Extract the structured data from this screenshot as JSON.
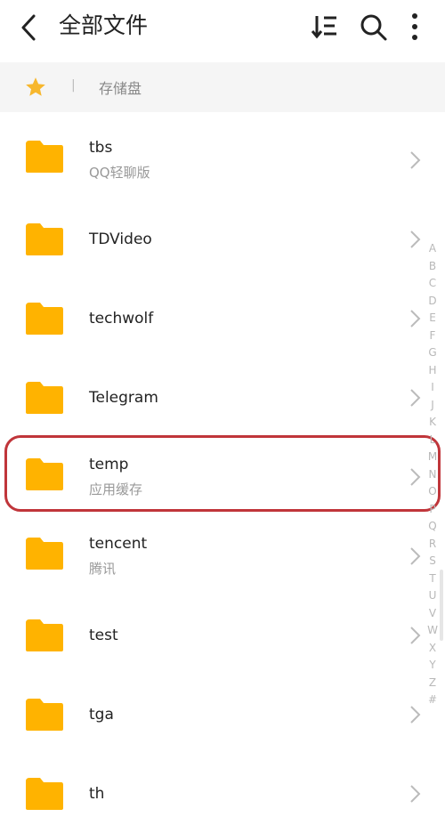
{
  "header": {
    "title": "全部文件"
  },
  "breadcrumb": {
    "separator": "|",
    "current": "存储盘"
  },
  "colors": {
    "folder": "#FFB300",
    "accent_star": "#F7B72D",
    "highlight": "#C0353A"
  },
  "icons": [
    "back-arrow-icon",
    "sort-icon",
    "search-icon",
    "more-vertical-icon",
    "star-icon",
    "folder-icon",
    "chevron-right-icon"
  ],
  "files": [
    {
      "name": "tbs",
      "sub": "QQ轻聊版"
    },
    {
      "name": "TDVideo",
      "sub": ""
    },
    {
      "name": "techwolf",
      "sub": ""
    },
    {
      "name": "Telegram",
      "sub": ""
    },
    {
      "name": "temp",
      "sub": "应用缓存"
    },
    {
      "name": "tencent",
      "sub": "腾讯"
    },
    {
      "name": "test",
      "sub": ""
    },
    {
      "name": "tga",
      "sub": ""
    },
    {
      "name": "th",
      "sub": ""
    }
  ],
  "alphabet": [
    "A",
    "B",
    "C",
    "D",
    "E",
    "F",
    "G",
    "H",
    "I",
    "J",
    "K",
    "L",
    "M",
    "N",
    "O",
    "P",
    "Q",
    "R",
    "S",
    "T",
    "U",
    "V",
    "W",
    "X",
    "Y",
    "Z",
    "#"
  ]
}
